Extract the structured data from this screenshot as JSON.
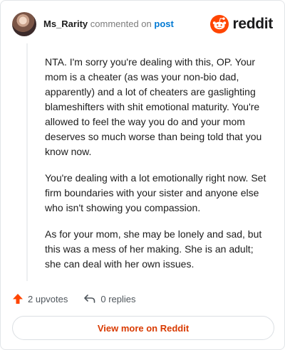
{
  "header": {
    "username": "Ms_Rarity",
    "commented_text": "commented on",
    "post_link": "post",
    "logo_text": "reddit"
  },
  "comment": {
    "paragraphs": [
      "NTA. I'm sorry you're dealing with this, OP. Your mom is a cheater (as was your non-bio dad, apparently) and a lot of cheaters are gaslighting blameshifters with shit emotional maturity. You're allowed to feel the way you do and your mom deserves so much worse than being told that you know now.",
      "You're dealing with a lot emotionally right now. Set firm boundaries with your sister and anyone else who isn't showing you compassion.",
      "As for your mom, she may be lonely and sad, but this was a mess of her making. She is an adult; she can deal with her own issues."
    ]
  },
  "actions": {
    "upvotes": "2 upvotes",
    "replies": "0 replies"
  },
  "cta": {
    "label": "View more on Reddit"
  },
  "colors": {
    "accent": "#ff4500",
    "link": "#0079d3",
    "cta_text": "#d93a00"
  },
  "icons": [
    "avatar",
    "reddit-logo-icon",
    "upvote-arrow-icon",
    "reply-arrow-icon"
  ]
}
